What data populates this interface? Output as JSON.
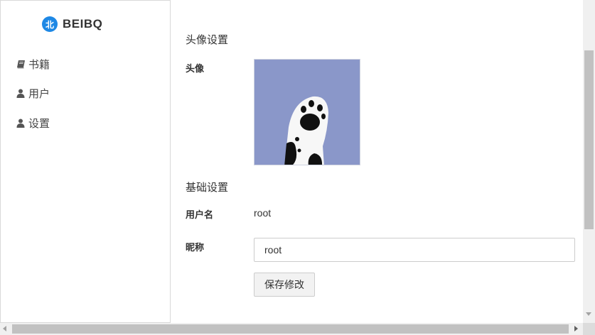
{
  "brand": {
    "logo_char": "北",
    "name": "BEIBQ",
    "logo_color": "#1e88e5"
  },
  "sidebar": {
    "items": [
      {
        "label": "书籍",
        "icon": "book-icon"
      },
      {
        "label": "用户",
        "icon": "user-icon"
      },
      {
        "label": "设置",
        "icon": "user-icon"
      }
    ]
  },
  "avatar_section": {
    "title": "头像设置",
    "label": "头像",
    "avatar_bg": "#8a97c9"
  },
  "basic_section": {
    "title": "基础设置",
    "username_label": "用户名",
    "username_value": "root",
    "nickname_label": "昵称",
    "nickname_value": "root"
  },
  "actions": {
    "save_label": "保存修改"
  }
}
